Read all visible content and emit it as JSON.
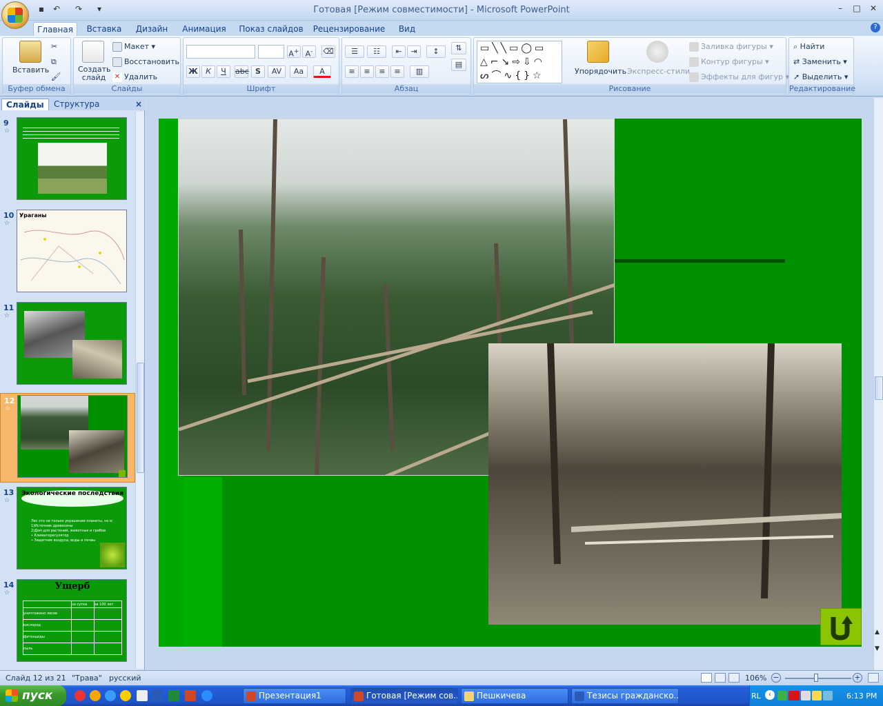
{
  "window": {
    "title": "Готовая [Режим совместимости] - Microsoft PowerPoint"
  },
  "ribbon_tabs": [
    "Главная",
    "Вставка",
    "Дизайн",
    "Анимация",
    "Показ слайдов",
    "Рецензирование",
    "Вид"
  ],
  "clipboard": {
    "label": "Буфер обмена",
    "paste": "Вставить"
  },
  "slides_group": {
    "label": "Слайды",
    "create": "Создать слайд",
    "layout": "Макет",
    "reset": "Восстановить",
    "delete": "Удалить"
  },
  "font_group": {
    "label": "Шрифт",
    "bold": "Ж",
    "italic": "К",
    "underline": "Ч",
    "strike": "abc",
    "shadow": "S",
    "spacing": "AV",
    "case": "Aa",
    "color": "A"
  },
  "paragraph_group": {
    "label": "Абзац"
  },
  "drawing_group": {
    "label": "Рисование",
    "arrange": "Упорядочить",
    "quick_styles": "Экспресс-стили",
    "fill": "Заливка фигуры",
    "outline": "Контур фигуры",
    "effects": "Эффекты для фигур"
  },
  "editing_group": {
    "label": "Редактирование",
    "find": "Найти",
    "replace": "Заменить",
    "select": "Выделить"
  },
  "left_pane": {
    "tab_slides": "Слайды",
    "tab_outline": "Структура",
    "close": "×"
  },
  "thumbnails": [
    {
      "num": "9",
      "star": "☆"
    },
    {
      "num": "10",
      "star": "☆",
      "text": "Ураганы"
    },
    {
      "num": "11",
      "star": "☆"
    },
    {
      "num": "12",
      "star": "☆"
    },
    {
      "num": "13",
      "star": "☆",
      "title": "Экологические последствия",
      "lines": [
        "Лес это не только украшение планеты, но и:",
        "1)Источник древесины",
        "2)Дом для растений, животных и грибов",
        "• Климаторегулятор",
        "• Защитник воздуха, воды и почвы"
      ]
    },
    {
      "num": "14",
      "star": "☆",
      "title": "Ущерб",
      "table_header": [
        "",
        "за сутки",
        "за 100 лет"
      ],
      "table_rows": [
        "уничтожено лесов",
        "кислород",
        "фитонциды",
        "пыль"
      ]
    }
  ],
  "status": {
    "slide": "Слайд 12 из 21",
    "theme": "\"Трава\"",
    "lang": "русский",
    "zoom": "106%"
  },
  "taskbar": {
    "start": "пуск",
    "items": [
      "Презентация1",
      "Готовая [Режим сов...",
      "Пешкичева",
      "Тезисы гражданско..."
    ],
    "lang": "RL",
    "time": "6:13 PM"
  },
  "colors": {
    "slide_bg": "#009000",
    "accent": "#f7b76a"
  }
}
